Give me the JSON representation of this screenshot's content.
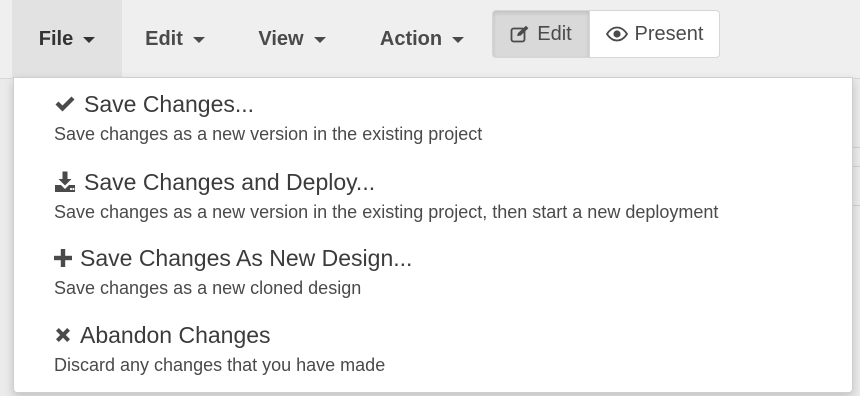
{
  "menubar": {
    "file_label": "File",
    "edit_label": "Edit",
    "view_label": "View",
    "action_label": "Action"
  },
  "mode_toggle": {
    "edit_label": "Edit",
    "present_label": "Present",
    "edit_icon": "pencil-square-icon",
    "present_icon": "eye-icon"
  },
  "file_menu": {
    "items": [
      {
        "icon": "checkmark-icon",
        "title": "Save Changes...",
        "description": "Save changes as a new version in the existing project"
      },
      {
        "icon": "download-icon",
        "title": "Save Changes and Deploy...",
        "description": "Save changes as a new version in the existing project, then start a new deployment"
      },
      {
        "icon": "plus-icon",
        "title": "Save Changes As New Design...",
        "description": "Save changes as a new cloned design"
      },
      {
        "icon": "x-icon",
        "title": "Abandon Changes",
        "description": "Discard any changes that you have made"
      }
    ]
  },
  "colors": {
    "menubar_bg": "#efefef",
    "active_menu_bg": "#e2e2e2",
    "text": "#4a4a4a",
    "dropdown_bg": "#ffffff"
  }
}
